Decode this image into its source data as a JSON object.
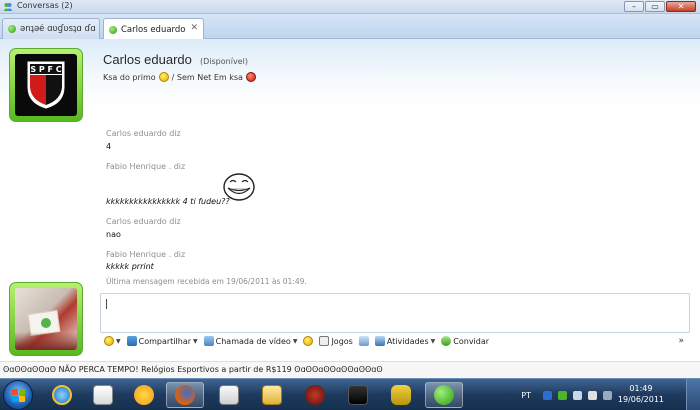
{
  "window": {
    "title": "Conversas (2)",
    "buttons": {
      "minimize": "–",
      "maximize": "▭",
      "close": "✕"
    }
  },
  "tabs": [
    {
      "label": "ənʇəé ɑʋɠʋsʇɑ ɗɑ cu...",
      "active": false
    },
    {
      "label": "Carlos eduardo",
      "active": true,
      "close": "✕"
    }
  ],
  "contact": {
    "name": "Carlos eduardo",
    "status": "(Disponível)",
    "message_before": "Ksa do primo",
    "message_after": "/ Sem Net Em ksa",
    "avatar_icon": "spfc-logo"
  },
  "conversation": [
    {
      "sender": "Carlos eduardo diz",
      "text": "4",
      "italic": false
    },
    {
      "sender": "Fabio Henrique . diz",
      "text": "kkkkkkkkkkkkkkkk 4 ti fudeu??",
      "italic": true,
      "emoticon": "troll-face-icon"
    },
    {
      "sender": "Carlos eduardo diz",
      "text": "nao",
      "italic": false
    },
    {
      "sender": "Fabio Henrique . diz",
      "text": "kkkkk prrint",
      "italic": true
    }
  ],
  "last_message": "Última mensagem recebida em 19/06/2011 às 01:49.",
  "toolbar": {
    "share": "Compartilhar",
    "video_call": "Chamada de vídeo",
    "games": "Jogos",
    "activities": "Atividades",
    "invite": "Convidar",
    "more": "»"
  },
  "ad": "ʘɑʘʘɑʘʘɑʘ NÃO PERCA TEMPO! Relógios Esportivos a partir de R$119 ʘɑʘʘɑʘʘɑʘʘɑʘʘɑʘ",
  "taskbar": {
    "language": "PT",
    "time": "01:49",
    "date": "19/06/2011"
  },
  "colors": {
    "online_green": "#57b820",
    "title_gradient_top": "#dfe9f5",
    "taskbar": "#1e3a5e"
  }
}
